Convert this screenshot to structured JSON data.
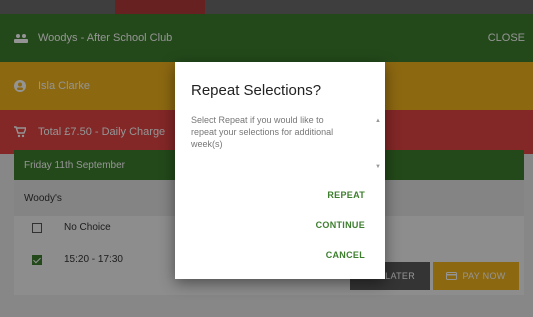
{
  "header": {
    "title": "Woodys - After School Club",
    "close_label": "CLOSE"
  },
  "user": {
    "name": "Isla Clarke"
  },
  "basket": {
    "total_text": "Total £7.50 - Daily Charge"
  },
  "day": {
    "label": "Friday 11th September"
  },
  "club": {
    "name": "Woody's"
  },
  "options": [
    {
      "label": "No Choice",
      "checked": false
    },
    {
      "label": "15:20 - 17:30",
      "checked": true
    }
  ],
  "footer": {
    "pay_later": "PAY LATER",
    "pay_now": "PAY NOW"
  },
  "dialog": {
    "title": "Repeat Selections?",
    "body": "Select Repeat if you would like to repeat your selections for additional week(s)",
    "repeat": "REPEAT",
    "continue": "CONTINUE",
    "cancel": "CANCEL"
  },
  "colors": {
    "green": "#3d7e2e",
    "amber": "#f2b41e",
    "red": "#e24444"
  }
}
